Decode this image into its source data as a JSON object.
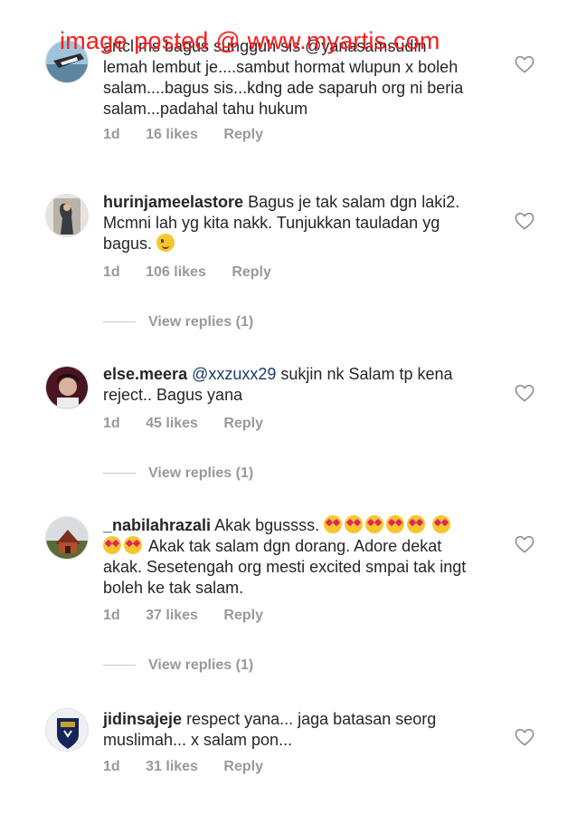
{
  "watermark": "image posted @ www.myartis.com",
  "comments": [
    {
      "username": "",
      "text": "artcl  ms bagus sungguh sis @yanasamsudin lemah lembut je....sambut hormat wlupun x boleh salam....bagus sis...kdng ade saparuh org ni beria salam...padahal tahu hukum",
      "time": "1d",
      "likes": "16 likes",
      "reply": "Reply"
    },
    {
      "username": "hurinjameelastore",
      "text": "Bagus je tak salam dgn laki2. Mcmni lah yg kita nakk. Tunjukkan tauladan yg bagus.",
      "emoji": "wink",
      "time": "1d",
      "likes": "106 likes",
      "reply": "Reply",
      "view_replies": "View replies (1)"
    },
    {
      "username": "else.meera",
      "mention": "@xxzuxx29",
      "text": "sukjin nk Salam tp kena reject.. Bagus yana",
      "time": "1d",
      "likes": "45 likes",
      "reply": "Reply",
      "view_replies": "View replies (1)"
    },
    {
      "username": "_nabilahrazali",
      "text_a": "Akak bgussss.",
      "text_b": "Akak tak salam dgn dorang. Adore dekat akak. Sesetengah org mesti excited smpai tak ingt boleh ke tak salam.",
      "emoji": "heart-eyes",
      "time": "1d",
      "likes": "37 likes",
      "reply": "Reply",
      "view_replies": "View replies (1)"
    },
    {
      "username": "jidinsajeje",
      "text": "respect yana... jaga batasan seorg muslimah... x salam pon...",
      "time": "1d",
      "likes": "31 likes",
      "reply": "Reply"
    }
  ],
  "colors": {
    "meta": "#999999",
    "text": "#262626",
    "watermark": "#ff1a1a",
    "mention": "#1c3a6b"
  },
  "icons": [
    "heart-outline-icon",
    "heart-eyes-emoji",
    "winking-face-emoji"
  ]
}
